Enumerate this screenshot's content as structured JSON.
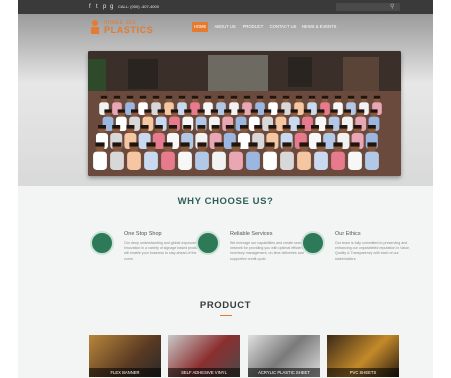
{
  "topbar": {
    "social": [
      "f",
      "t",
      "p",
      "g"
    ],
    "call": "CALL: (000) -407-4000",
    "search_placeholder": ""
  },
  "logo": {
    "top": "SHREE JEE",
    "main": "PLASTICS"
  },
  "nav": {
    "items": [
      {
        "label": "HOME",
        "active": true
      },
      {
        "label": "ABOUT US",
        "active": false
      },
      {
        "label": "PRODUCT",
        "active": false
      },
      {
        "label": "CONTACT US",
        "active": false
      },
      {
        "label": "NEWS & EVENTS",
        "active": false
      }
    ]
  },
  "why": {
    "title": "WHY CHOOSE US?",
    "features": [
      {
        "title": "One Stop Shop",
        "text": "Our deep understanding and global exposure to innovation in a variety of signage based products will enable your business to stay ahead of the curve.",
        "icon": "one-stop-shop-icon"
      },
      {
        "title": "Reliable Services",
        "text": "We leverage our capabilities and create seamless network for providing you with optimal efficiency in inventory management, on-time deliveries and supportive credit cycle.",
        "icon": "reliable-services-icon"
      },
      {
        "title": "Our Ethics",
        "text": "Our team is fully committed to preserving and enhancing our unparalleled reputation in Value, Quality & Transparency with each of our stakeholders.",
        "icon": "our-ethics-icon"
      }
    ]
  },
  "product": {
    "title": "PRODUCT",
    "cards": [
      {
        "label": "FLEX BANNER"
      },
      {
        "label": "SELF ADHESIVE VINYL"
      },
      {
        "label": "ACRYLIC PLASTIC SHEET"
      },
      {
        "label": "PVC SHEETS"
      }
    ]
  },
  "colors": {
    "accent": "#e57b2e",
    "heading_green": "#2f5f57",
    "icon_green": "#2d7a58",
    "topbar": "#3a3a3a"
  }
}
